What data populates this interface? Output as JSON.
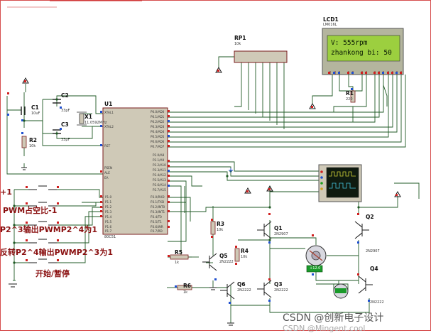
{
  "lcd": {
    "ref": "LCD1",
    "model": "LM016L",
    "line1": "V:  555rpm",
    "line2": "zhankong bi: 50"
  },
  "mcu": {
    "ref": "U1",
    "model": "80C51",
    "xtal1": "XTAL1",
    "xtal2": "XTAL2",
    "rst": "RST",
    "psen": "PSEN",
    "ale": "ALE",
    "ea": "EA",
    "p0_pins": [
      "P0.0/AD0",
      "P0.1/AD1",
      "P0.2/AD2",
      "P0.3/AD3",
      "P0.4/AD4",
      "P0.5/AD5",
      "P0.6/AD6",
      "P0.7/AD7"
    ],
    "p2_pins": [
      "P2.0/A8",
      "P2.1/A9",
      "P2.2/A10",
      "P2.3/A11",
      "P2.4/A12",
      "P2.5/A13",
      "P2.6/A14",
      "P2.7/A15"
    ],
    "p3_pins": [
      "P3.0/RXD",
      "P3.1/TXD",
      "P3.2/INT0",
      "P3.3/INT1",
      "P3.4/T0",
      "P3.5/T1",
      "P3.6/WR",
      "P3.7/RD"
    ],
    "p1_pins": [
      "P1.0",
      "P1.1",
      "P1.2",
      "P1.3",
      "P1.4",
      "P1.5",
      "P1.6",
      "P1.7"
    ]
  },
  "components": {
    "rp1": {
      "ref": "RP1",
      "value": "10k"
    },
    "r1": {
      "ref": "R1",
      "value": "220"
    },
    "r2": {
      "ref": "R2",
      "value": "10k"
    },
    "r3": {
      "ref": "R3",
      "value": "10k"
    },
    "r4": {
      "ref": "R4",
      "value": "10k"
    },
    "r5": {
      "ref": "R5",
      "value": "1k"
    },
    "r6": {
      "ref": "R6",
      "value": "1k"
    },
    "c1": {
      "ref": "C1",
      "value": "10uF"
    },
    "c2": {
      "ref": "C2",
      "value": "33pF"
    },
    "c3": {
      "ref": "C3",
      "value": "33pF"
    },
    "x1": {
      "ref": "X1",
      "value": "11.0592MHz"
    },
    "q1": {
      "ref": "Q1",
      "value": "2N2907"
    },
    "q2": {
      "ref": "Q2",
      "value": "2N2907"
    },
    "q3": {
      "ref": "Q3",
      "value": "2N2222"
    },
    "q4": {
      "ref": "Q4",
      "value": "2N2222"
    },
    "q5": {
      "ref": "Q5",
      "value": "2N2222"
    },
    "q6": {
      "ref": "Q6",
      "value": "2N2222"
    },
    "motor_speed": "+12.0"
  },
  "buttons": {
    "b1": "+1",
    "b2": "PWM占空比-1",
    "b3": "P2^3输出PWMP2^4为1",
    "b4": "反转P2^4输出PWMP2^3为1",
    "b5": "开始/暂停"
  },
  "watermark": {
    "main": "CSDN @创新电子设计",
    "shadow": "CSDN @Mingent.cool"
  },
  "colors": {
    "wire": "#1f5a24",
    "body": "#cfc9b7",
    "outline": "#7a1c1c",
    "lcd_bg": "#9ccf3f",
    "button_text": "#8a1010"
  }
}
